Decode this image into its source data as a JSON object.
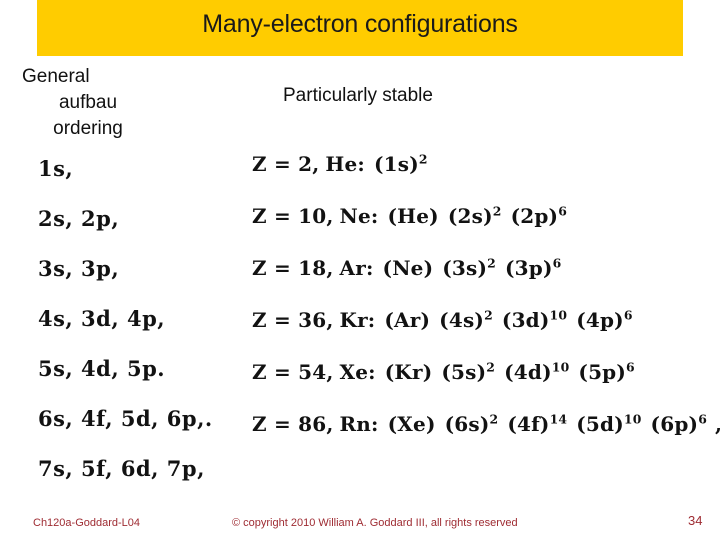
{
  "slide": {
    "title": "Many-electron configurations",
    "banner_color": "#FFCC00",
    "background_color": "#FFFFFF"
  },
  "headings": {
    "left_line1": "General",
    "left_line2": "aufbau",
    "left_line3": "ordering",
    "right": "Particularly stable"
  },
  "aufbau_ordering": [
    {
      "text": "1s,"
    },
    {
      "text": "2s, 2p,"
    },
    {
      "text": "3s, 3p,"
    },
    {
      "text": "4s, 3d, 4p,"
    },
    {
      "text": "5s, 4d, 5p."
    },
    {
      "text": "6s, 4f, 5d, 6p,."
    },
    {
      "text": "7s, 5f, 6d, 7p,"
    }
  ],
  "configurations": [
    {
      "z_label": "Z =  2,",
      "element": "He:",
      "shells": [
        {
          "base": "(1s)",
          "exp": "2"
        }
      ],
      "trailing": ""
    },
    {
      "z_label": "Z = 10,",
      "element": "Ne:",
      "shells": [
        {
          "base": "(He)",
          "exp": ""
        },
        {
          "base": "(2s)",
          "exp": "2"
        },
        {
          "base": "(2p)",
          "exp": "6"
        }
      ],
      "trailing": ""
    },
    {
      "z_label": "Z = 18,",
      "element": "Ar:",
      "shells": [
        {
          "base": "(Ne)",
          "exp": ""
        },
        {
          "base": "(3s)",
          "exp": "2"
        },
        {
          "base": "(3p)",
          "exp": "6"
        }
      ],
      "trailing": ""
    },
    {
      "z_label": "Z = 36,",
      "element": "Kr:",
      "shells": [
        {
          "base": "(Ar)",
          "exp": ""
        },
        {
          "base": "(4s)",
          "exp": "2"
        },
        {
          "base": "(3d)",
          "exp": "10"
        },
        {
          "base": "(4p)",
          "exp": "6"
        }
      ],
      "trailing": ""
    },
    {
      "z_label": "Z = 54,",
      "element": "Xe:",
      "shells": [
        {
          "base": "(Kr)",
          "exp": ""
        },
        {
          "base": "(5s)",
          "exp": "2"
        },
        {
          "base": "(4d)",
          "exp": "10"
        },
        {
          "base": "(5p)",
          "exp": "6"
        }
      ],
      "trailing": ""
    },
    {
      "z_label": "Z = 86,",
      "element": "Rn:",
      "shells": [
        {
          "base": "(Xe)",
          "exp": ""
        },
        {
          "base": "(6s)",
          "exp": "2"
        },
        {
          "base": "(4f)",
          "exp": "14"
        },
        {
          "base": "(5d)",
          "exp": "10"
        },
        {
          "base": "(6p)",
          "exp": "6"
        }
      ],
      "trailing": ","
    }
  ],
  "footer": {
    "course": "Ch120a-Goddard-L04",
    "copyright": "© copyright 2010 William A. Goddard III, all rights reserved",
    "page_number": "34",
    "color": "#9E2B32"
  }
}
